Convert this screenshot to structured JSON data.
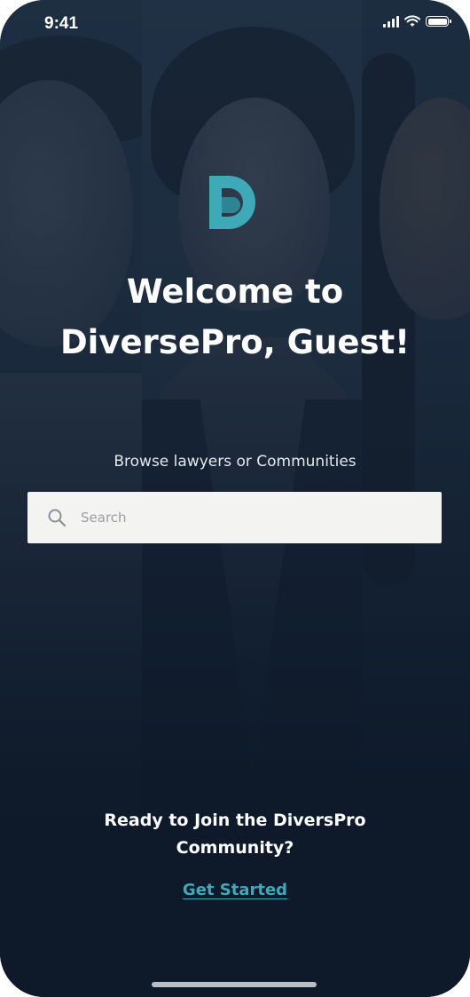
{
  "status_bar": {
    "time": "9:41",
    "icons": [
      "signal-icon",
      "wifi-icon",
      "battery-icon"
    ]
  },
  "brand": {
    "logo_icon": "dp-logo-icon",
    "accent_color": "#3ea9b7"
  },
  "welcome": {
    "line1": "Welcome to",
    "line2": "DiversePro, Guest!"
  },
  "browse": {
    "label": "Browse lawyers or Communities"
  },
  "search": {
    "placeholder": "Search",
    "icon": "search-icon"
  },
  "join": {
    "line1": "Ready to Join the DiversPro",
    "line2": "Community?",
    "link_label": "Get Started"
  }
}
